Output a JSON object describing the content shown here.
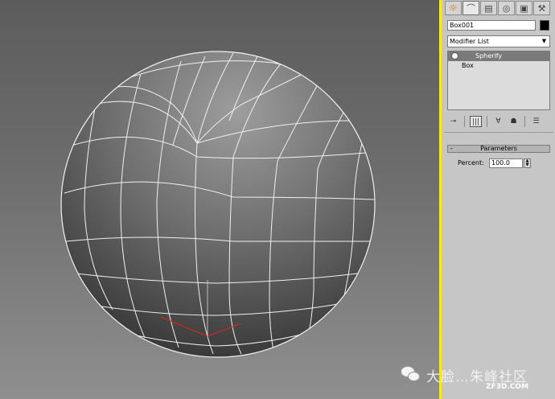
{
  "panel": {
    "tabs": [
      {
        "name": "create",
        "icon": "create-icon",
        "glyph": "☼"
      },
      {
        "name": "modify",
        "icon": "modify-icon",
        "glyph": "⌒"
      },
      {
        "name": "hierarchy",
        "icon": "hierarchy-icon",
        "glyph": "▤"
      },
      {
        "name": "motion",
        "icon": "motion-icon",
        "glyph": "◎"
      },
      {
        "name": "display",
        "icon": "display-icon",
        "glyph": "▣"
      },
      {
        "name": "utilities",
        "icon": "utilities-icon",
        "glyph": "⚒"
      }
    ],
    "object_name": "Box001",
    "object_color": "#000000",
    "modifier_list_label": "Modifier List",
    "stack": [
      {
        "label": "Spherify",
        "selected": true
      },
      {
        "label": "Box",
        "selected": false
      }
    ],
    "stack_tools": {
      "pin": "⊸",
      "show_end_result": "|||",
      "make_unique": "∀",
      "remove_modifier": "☗",
      "configure": "☰"
    },
    "rollout_title": "Parameters",
    "rollout_toggle": "-",
    "percent_label": "Percent:",
    "percent_value": "100.0"
  },
  "watermark": {
    "text": "大脸…朱峰社区",
    "site": "ZF3D.COM"
  },
  "colors": {
    "viewport_border": "#f2ea28",
    "panel_bg": "#c6c6c6",
    "selected_row": "#7a7a7a",
    "gizmo": "#d4281c"
  }
}
